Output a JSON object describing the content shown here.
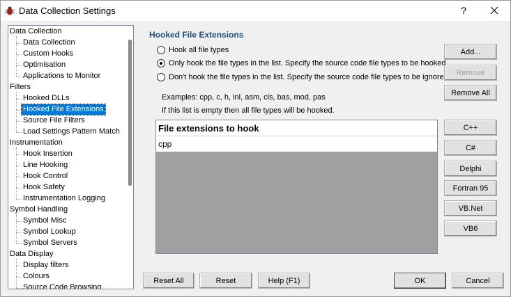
{
  "window": {
    "title": "Data Collection Settings",
    "help_label": "?"
  },
  "tree": {
    "groups": [
      {
        "label": "Data Collection",
        "children": [
          "Data Collection",
          "Custom Hooks",
          "Optimisation",
          "Applications to Monitor"
        ]
      },
      {
        "label": "Filters",
        "children": [
          "Hooked DLLs",
          "Hooked File Extensions",
          "Source File Filters",
          "Load Settings Pattern Match"
        ]
      },
      {
        "label": "Instrumentation",
        "children": [
          "Hook Insertion",
          "Line Hooking",
          "Hook Control",
          "Hook Safety",
          "Instrumentation Logging"
        ]
      },
      {
        "label": "Symbol Handling",
        "children": [
          "Symbol Misc",
          "Symbol Lookup",
          "Symbol Servers"
        ]
      },
      {
        "label": "Data Display",
        "children": [
          "Display filters",
          "Colours",
          "Source Code Browsing"
        ]
      }
    ],
    "selected": "Hooked File Extensions"
  },
  "panel": {
    "title": "Hooked File Extensions",
    "options": [
      {
        "label": "Hook all file types",
        "checked": false
      },
      {
        "label": "Only hook the file types in the list. Specify the source code file types to be hooked",
        "checked": true
      },
      {
        "label": "Don't hook the file types in the list. Specify the source code file types to be ignored",
        "checked": false
      }
    ],
    "examples": "Examples: cpp, c, h, inl, asm, cls, bas, mod, pas",
    "empty_note": "If this list is empty then all file types will be hooked.",
    "list_header": "File extensions to hook",
    "list_items": [
      "cpp"
    ]
  },
  "side_buttons": {
    "add": "Add...",
    "remove": "Remove",
    "remove_all": "Remove All",
    "cpp": "C++",
    "csharp": "C#",
    "delphi": "Delphi",
    "fortran": "Fortran 95",
    "vbnet": "VB.Net",
    "vb6": "VB6"
  },
  "bottom_buttons": {
    "reset_all": "Reset All",
    "reset": "Reset",
    "help": "Help (F1)",
    "ok": "OK",
    "cancel": "Cancel"
  }
}
